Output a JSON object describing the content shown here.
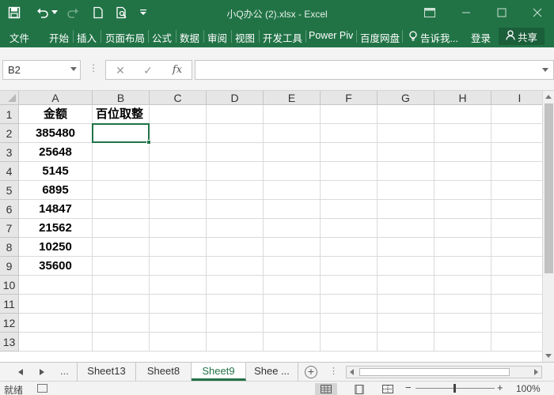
{
  "window": {
    "title": "小Q办公 (2).xlsx - Excel"
  },
  "ribbon": {
    "tabs": [
      "文件",
      "开始",
      "插入",
      "页面布局",
      "公式",
      "数据",
      "审阅",
      "视图",
      "开发工具",
      "Power Piv",
      "百度网盘"
    ],
    "tell_me": "告诉我...",
    "login": "登录",
    "share": "共享"
  },
  "formula_bar": {
    "name_box": "B2",
    "cancel_glyph": "✕",
    "enter_glyph": "✓",
    "fx_label": "fx",
    "formula": ""
  },
  "grid": {
    "columns": [
      "A",
      "B",
      "C",
      "D",
      "E",
      "F",
      "G",
      "H",
      "I"
    ],
    "rows": [
      "1",
      "2",
      "3",
      "4",
      "5",
      "6",
      "7",
      "8",
      "9",
      "10",
      "11",
      "12",
      "13"
    ],
    "cells": {
      "A1": "金额",
      "B1": "百位取整",
      "A2": "385480",
      "A3": "25648",
      "A4": "5145",
      "A5": "6895",
      "A6": "14847",
      "A7": "21562",
      "A8": "10250",
      "A9": "35600"
    },
    "selected_cell": "B2"
  },
  "sheet_tabs": {
    "more": "...",
    "tabs": [
      {
        "label": "Sheet13",
        "active": false
      },
      {
        "label": "Sheet8",
        "active": false
      },
      {
        "label": "Sheet9",
        "active": true
      },
      {
        "label": "Shee ...",
        "active": false
      }
    ]
  },
  "status_bar": {
    "ready": "就绪",
    "zoom": "100%"
  },
  "colors": {
    "accent": "#217346",
    "grid_line": "#dadada",
    "header_bg": "#e6e6e6"
  }
}
